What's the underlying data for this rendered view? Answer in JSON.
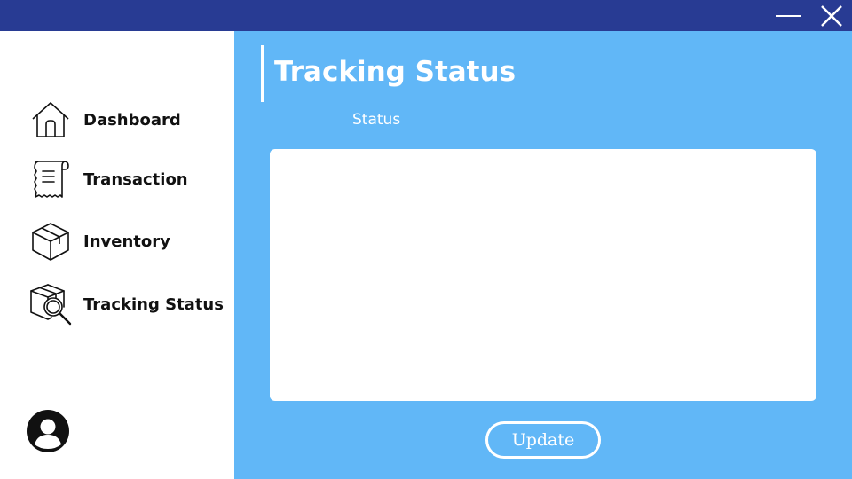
{
  "window": {
    "minimize_icon": "minimize-icon",
    "close_icon": "close-icon",
    "titlebar_color": "#283b93"
  },
  "sidebar": {
    "items": [
      {
        "label": "Dashboard",
        "icon": "home-icon"
      },
      {
        "label": "Transaction",
        "icon": "receipt-icon"
      },
      {
        "label": "Inventory",
        "icon": "box-icon"
      },
      {
        "label": "Tracking Status",
        "icon": "package-search-icon"
      }
    ],
    "avatar_icon": "user-avatar-icon"
  },
  "main": {
    "title": "Tracking Status",
    "status_label": "Status",
    "status_value": "",
    "update_label": "Update",
    "background_color": "#61b7f7"
  }
}
